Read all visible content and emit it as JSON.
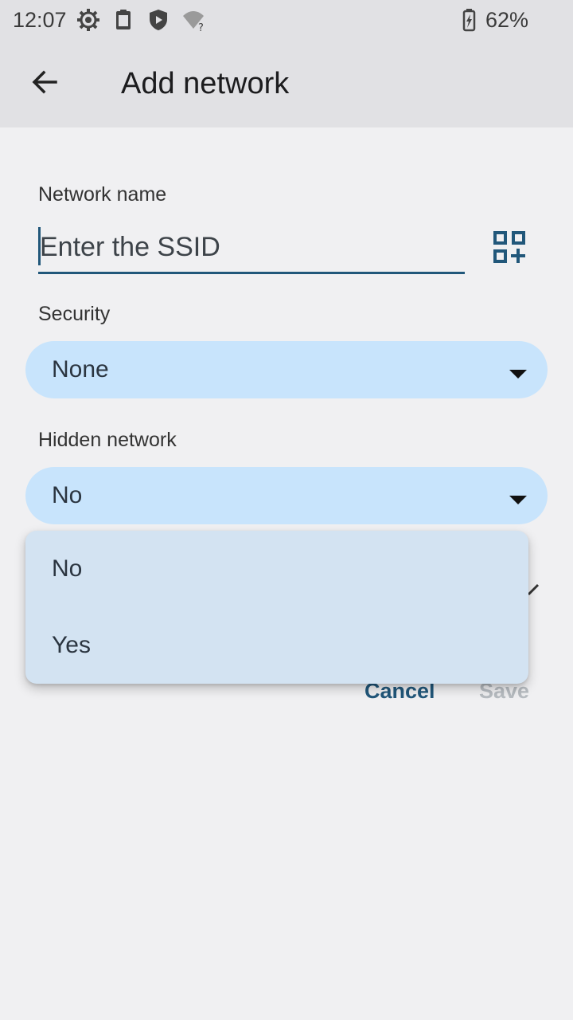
{
  "status_bar": {
    "time": "12:07",
    "icons": [
      "settings-gear-icon",
      "clipboard-icon",
      "shield-play-icon",
      "wifi-unknown-icon"
    ],
    "battery_icon": "battery-charging-icon",
    "battery": "62%"
  },
  "app_bar": {
    "back_icon": "arrow-left-icon",
    "title": "Add network"
  },
  "form": {
    "network_name_label": "Network name",
    "ssid_placeholder": "Enter the SSID",
    "ssid_value": "",
    "qr_icon": "qr-code-add-icon",
    "security_label": "Security",
    "security_value": "None",
    "hidden_label": "Hidden network",
    "hidden_value": "No"
  },
  "dropdown": {
    "options": [
      "No",
      "Yes"
    ]
  },
  "actions": {
    "cancel": "Cancel",
    "save": "Save"
  },
  "colors": {
    "accent": "#21577a",
    "select_bg": "#c8e4fc",
    "menu_bg": "#d3e3f2",
    "disabled": "#b7bcc1"
  }
}
